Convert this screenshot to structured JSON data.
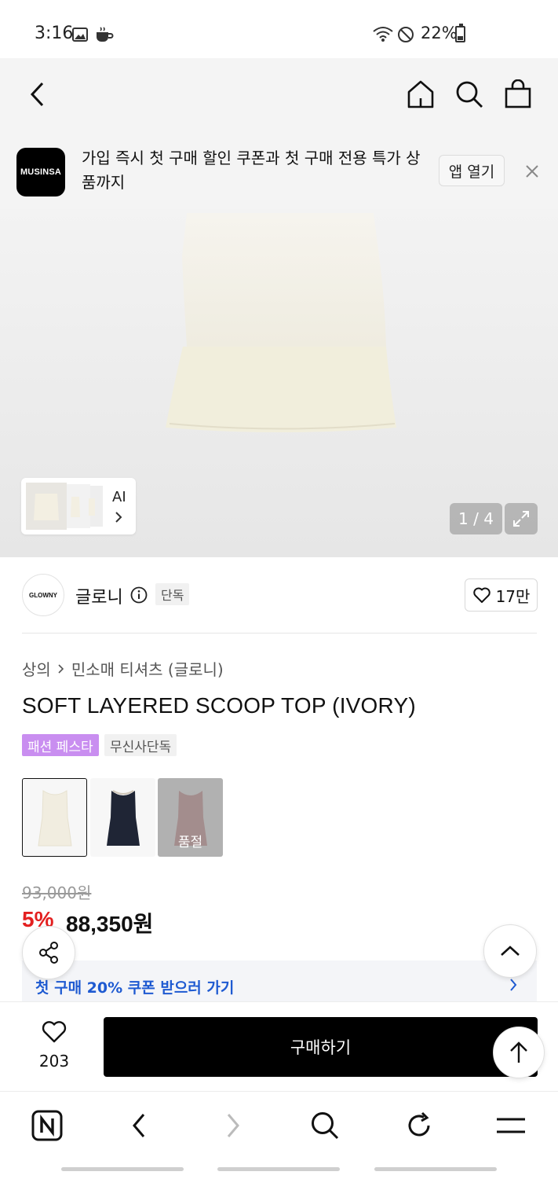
{
  "status_bar": {
    "time": "3:16",
    "battery_text": "22%"
  },
  "app_banner": {
    "logo_text": "MUSINSA",
    "message": "가입 즉시 첫 구매 할인 쿠폰과 첫 구매 전용 특가 상품까지",
    "open_app_label": "앱 열기"
  },
  "gallery": {
    "ai_label": "AI",
    "counter": "1 / 4"
  },
  "brand": {
    "logo_text": "GLOWNY",
    "name": "글로니",
    "badge": "단독",
    "like_count": "17만"
  },
  "breadcrumb": {
    "category": "상의",
    "subcategory": "민소매 티셔츠 (글로니)"
  },
  "product": {
    "title": "SOFT LAYERED SCOOP TOP (IVORY)",
    "tags": [
      "패션 페스타",
      "무신사단독"
    ],
    "colors": [
      {
        "name": "ivory",
        "swatch": "#f1ede0",
        "soldout": ""
      },
      {
        "name": "navy",
        "swatch": "#1f2535",
        "soldout": ""
      },
      {
        "name": "pink",
        "swatch": "#d8a7a6",
        "soldout": "품절"
      }
    ],
    "original_price": "93,000원",
    "discount": "5%",
    "sale_price": "88,350원"
  },
  "coupon": {
    "text": "첫 구매 20% 쿠폰 받으러 가기"
  },
  "purchase": {
    "wish_count": "203",
    "buy_label": "구매하기"
  },
  "colors": {
    "accent_fest": "#c98ef0",
    "discount_red": "#e32020",
    "coupon_blue": "#1e5ad1"
  }
}
